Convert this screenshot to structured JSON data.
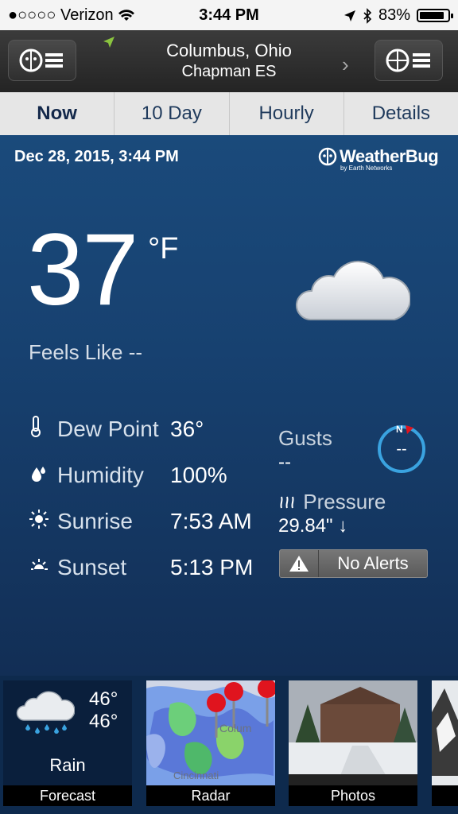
{
  "status_bar": {
    "carrier": "Verizon",
    "time": "3:44 PM",
    "battery": "83%"
  },
  "header": {
    "city": "Columbus, Ohio",
    "station": "Chapman ES"
  },
  "tabs": [
    {
      "label": "Now",
      "active": true
    },
    {
      "label": "10 Day"
    },
    {
      "label": "Hourly"
    },
    {
      "label": "Details"
    }
  ],
  "current": {
    "datetime": "Dec 28, 2015, 3:44 PM",
    "brand_name": "WeatherBug",
    "brand_sub": "by Earth Networks",
    "temperature": "37",
    "unit": "°F",
    "feels_like": "Feels Like --",
    "condition_icon": "cloud-icon"
  },
  "stats": {
    "dew_point": {
      "label": "Dew Point",
      "value": "36°"
    },
    "humidity": {
      "label": "Humidity",
      "value": "100%"
    },
    "sunrise": {
      "label": "Sunrise",
      "value": "7:53 AM"
    },
    "sunset": {
      "label": "Sunset",
      "value": "5:13 PM"
    }
  },
  "wind": {
    "gusts_label": "Gusts",
    "gusts_value": "--",
    "compass_value": "--",
    "compass_letter": "N"
  },
  "pressure": {
    "label": "Pressure",
    "value": "29.84\"",
    "trend": "↓"
  },
  "alerts": {
    "label": "No Alerts"
  },
  "bottom": {
    "forecast": {
      "hi": "46°",
      "lo": "46°",
      "condition": "Rain",
      "caption": "Forecast"
    },
    "radar": {
      "caption": "Radar",
      "map_label_1": "Colum",
      "map_label_2": "Cincinnati"
    },
    "photos": {
      "caption": "Photos"
    }
  },
  "colors": {
    "accent_blue": "#3aa3e0",
    "main_bg": "#174170",
    "pin_red": "#e0141e"
  }
}
